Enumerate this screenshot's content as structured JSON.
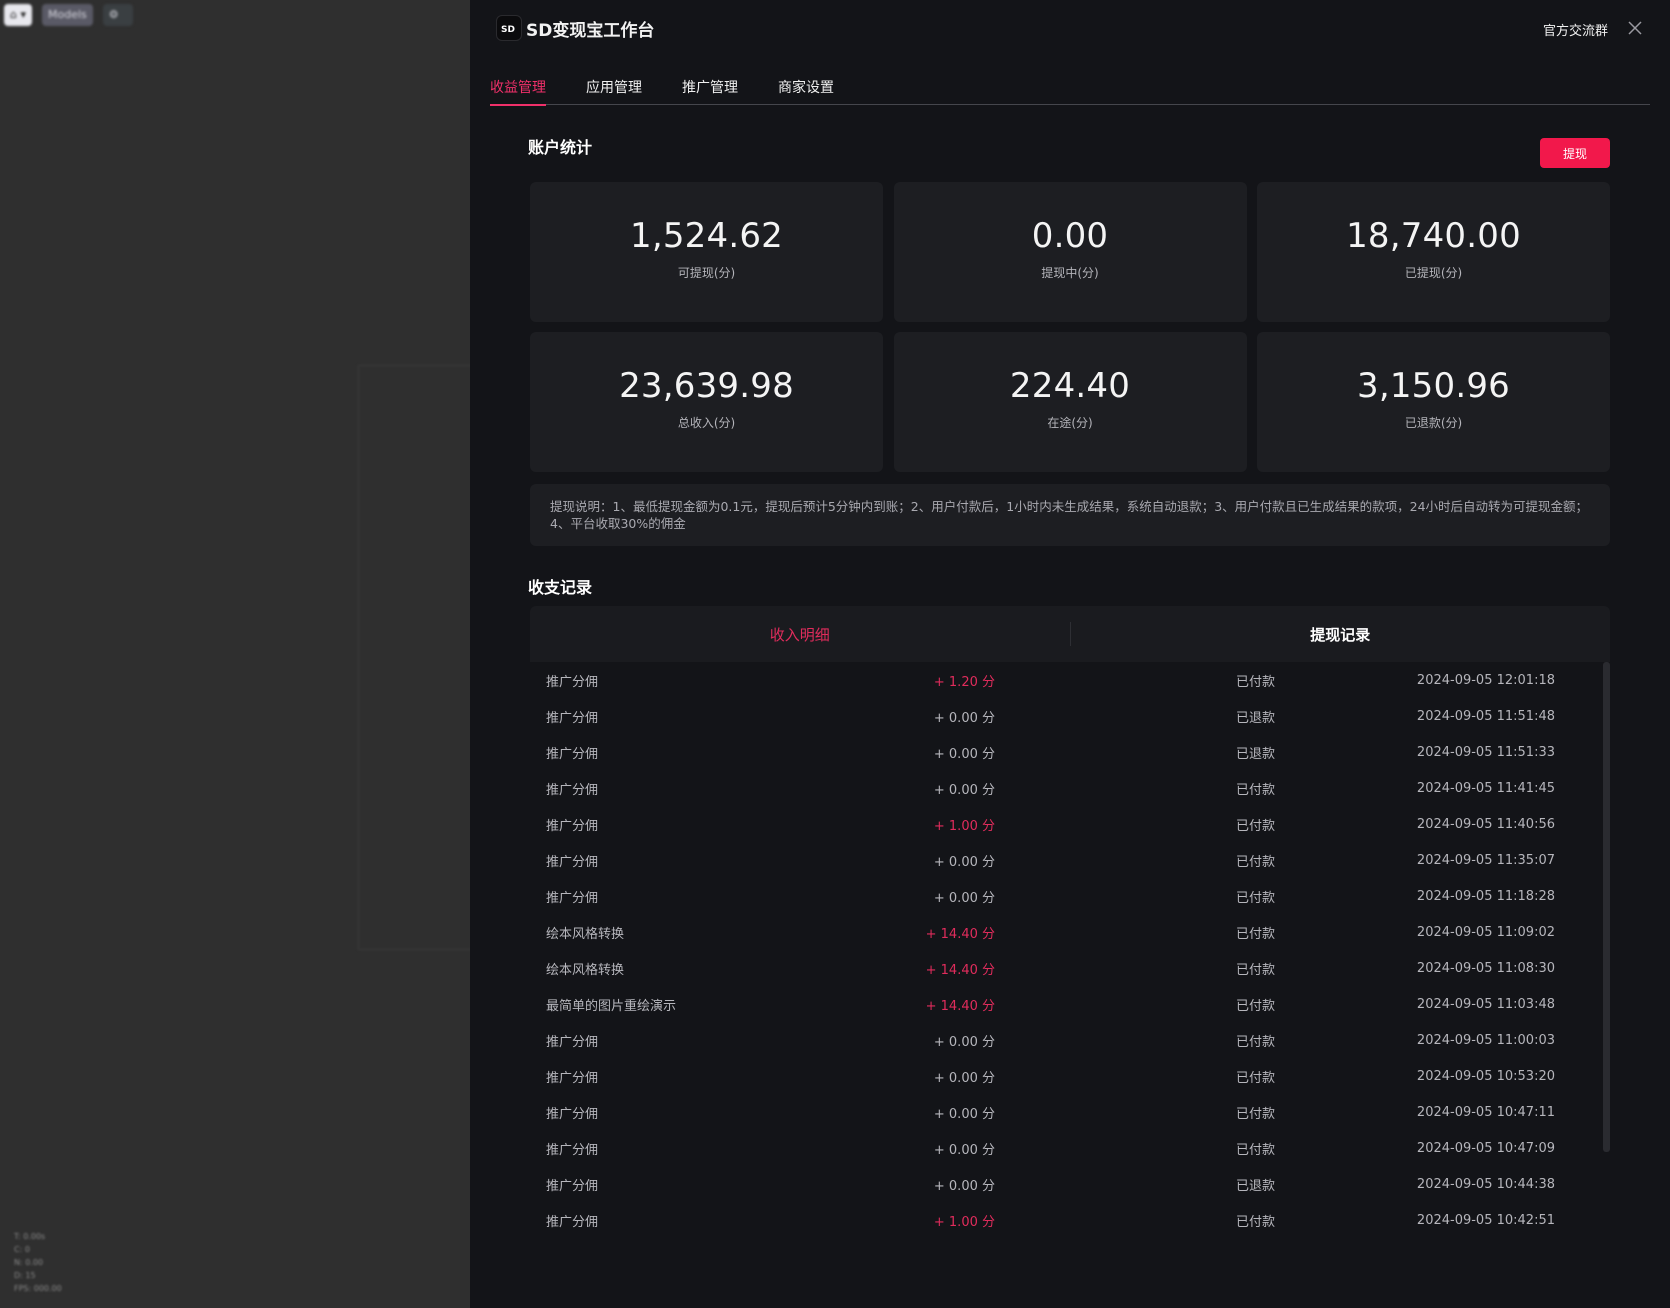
{
  "background": {
    "chips": [
      "⌂ ▾",
      "Models",
      "⚙"
    ],
    "stats": [
      "T: 0.00s",
      "C: 0",
      "N: 0.00",
      "D: 15",
      "FPS: 000.00"
    ]
  },
  "header": {
    "logo_text": "SD",
    "title": "SD变现宝工作台",
    "community_link": "官方交流群"
  },
  "tabs": [
    {
      "label": "收益管理",
      "active": true
    },
    {
      "label": "应用管理",
      "active": false
    },
    {
      "label": "推广管理",
      "active": false
    },
    {
      "label": "商家设置",
      "active": false
    }
  ],
  "account": {
    "title": "账户统计",
    "withdraw_label": "提现",
    "stats": [
      {
        "value": "1,524.62",
        "label": "可提现(分)"
      },
      {
        "value": "0.00",
        "label": "提现中(分)"
      },
      {
        "value": "18,740.00",
        "label": "已提现(分)"
      },
      {
        "value": "23,639.98",
        "label": "总收入(分)"
      },
      {
        "value": "224.40",
        "label": "在途(分)"
      },
      {
        "value": "3,150.96",
        "label": "已退款(分)"
      }
    ],
    "notice": "提现说明：1、最低提现金额为0.1元，提现后预计5分钟内到账；2、用户付款后，1小时内未生成结果，系统自动退款；3、用户付款且已生成结果的款项，24小时后自动转为可提现金额；4、平台收取30%的佣金"
  },
  "records": {
    "title": "收支记录",
    "tabs": [
      "收入明细",
      "提现记录"
    ],
    "rows": [
      {
        "name": "推广分佣",
        "amount": "+ 1.20 分",
        "positive": true,
        "status": "已付款",
        "time": "2024-09-05 12:01:18"
      },
      {
        "name": "推广分佣",
        "amount": "+ 0.00 分",
        "positive": false,
        "status": "已退款",
        "time": "2024-09-05 11:51:48"
      },
      {
        "name": "推广分佣",
        "amount": "+ 0.00 分",
        "positive": false,
        "status": "已退款",
        "time": "2024-09-05 11:51:33"
      },
      {
        "name": "推广分佣",
        "amount": "+ 0.00 分",
        "positive": false,
        "status": "已付款",
        "time": "2024-09-05 11:41:45"
      },
      {
        "name": "推广分佣",
        "amount": "+ 1.00 分",
        "positive": true,
        "status": "已付款",
        "time": "2024-09-05 11:40:56"
      },
      {
        "name": "推广分佣",
        "amount": "+ 0.00 分",
        "positive": false,
        "status": "已付款",
        "time": "2024-09-05 11:35:07"
      },
      {
        "name": "推广分佣",
        "amount": "+ 0.00 分",
        "positive": false,
        "status": "已付款",
        "time": "2024-09-05 11:18:28"
      },
      {
        "name": "绘本风格转换",
        "amount": "+ 14.40 分",
        "positive": true,
        "status": "已付款",
        "time": "2024-09-05 11:09:02"
      },
      {
        "name": "绘本风格转换",
        "amount": "+ 14.40 分",
        "positive": true,
        "status": "已付款",
        "time": "2024-09-05 11:08:30"
      },
      {
        "name": "最简单的图片重绘演示",
        "amount": "+ 14.40 分",
        "positive": true,
        "status": "已付款",
        "time": "2024-09-05 11:03:48"
      },
      {
        "name": "推广分佣",
        "amount": "+ 0.00 分",
        "positive": false,
        "status": "已付款",
        "time": "2024-09-05 11:00:03"
      },
      {
        "name": "推广分佣",
        "amount": "+ 0.00 分",
        "positive": false,
        "status": "已付款",
        "time": "2024-09-05 10:53:20"
      },
      {
        "name": "推广分佣",
        "amount": "+ 0.00 分",
        "positive": false,
        "status": "已付款",
        "time": "2024-09-05 10:47:11"
      },
      {
        "name": "推广分佣",
        "amount": "+ 0.00 分",
        "positive": false,
        "status": "已付款",
        "time": "2024-09-05 10:47:09"
      },
      {
        "name": "推广分佣",
        "amount": "+ 0.00 分",
        "positive": false,
        "status": "已退款",
        "time": "2024-09-05 10:44:38"
      },
      {
        "name": "推广分佣",
        "amount": "+ 1.00 分",
        "positive": true,
        "status": "已付款",
        "time": "2024-09-05 10:42:51"
      }
    ]
  },
  "colors": {
    "accent": "#f0306a",
    "button": "#f2184b",
    "positive_amount": "#e02c5c",
    "panel_bg": "#131418",
    "card_bg": "#1d1e22"
  }
}
